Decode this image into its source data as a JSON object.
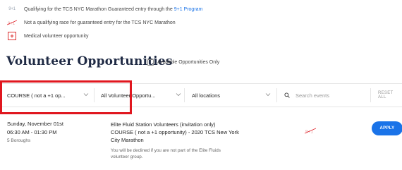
{
  "legend": {
    "guaranteed_badge": "9+1",
    "guaranteed_text": "Qualifying for the TCS NYC Marathon Guaranteed entry through the",
    "guaranteed_link": "9+1 Program",
    "not_qualifying_text": "Not a qualifying race for guaranteed entry for the TCS NYC Marathon",
    "medical_text": "Medical volunteer opportunity"
  },
  "page": {
    "title": "Volunteer Opportunities",
    "available_only_label": "Available Opportunities Only"
  },
  "filters": {
    "course": "COURSE ( not a +1 op...",
    "opportunity": "All Volunteer Opportu...",
    "location": "All locations",
    "search_placeholder": "Search events",
    "reset_label": "RESET ALL"
  },
  "event": {
    "date": "Sunday, November 01st",
    "time": "06:30 AM - 01:30 PM",
    "location": "5 Boroughs",
    "title_line1": "Elite Fluid Station Volunteers (invitation only)",
    "title_line2": "COURSE ( not a +1 opportunity) - 2020 TCS New York",
    "title_line3": "City Marathon",
    "note_line1": "You will be declined if you are not part of the Elite Fluids",
    "note_line2": "volunteer group.",
    "apply_label": "APPLY"
  },
  "colors": {
    "accent": "#1a73e8",
    "highlight": "#e0171f",
    "title": "#1f2a44"
  }
}
